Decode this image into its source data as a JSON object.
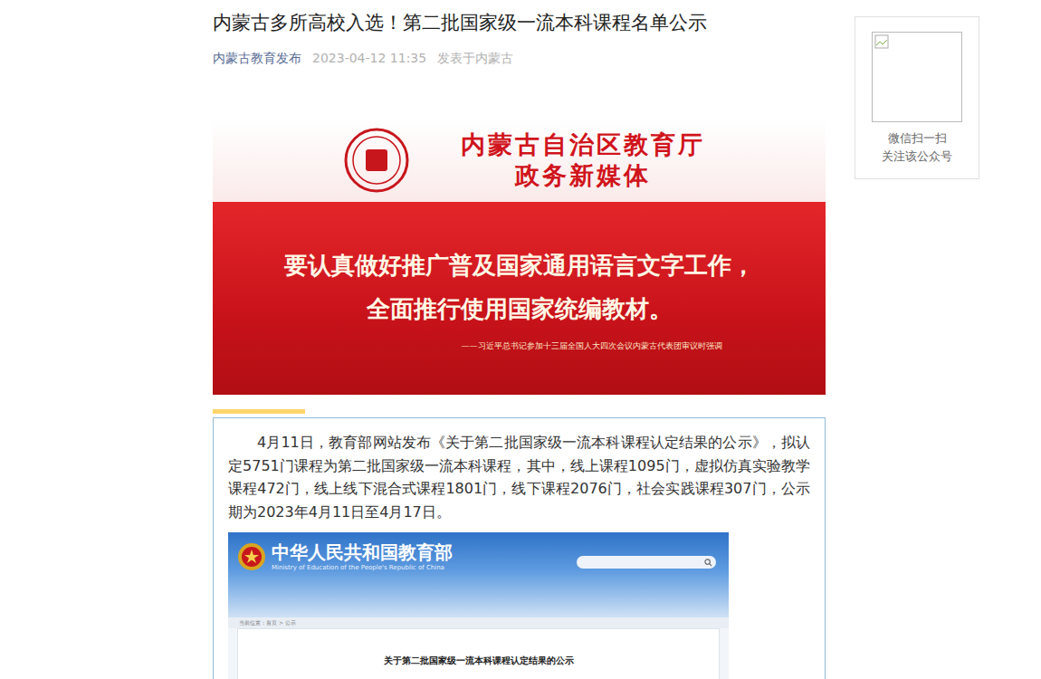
{
  "article": {
    "title": "内蒙古多所高校入选！第二批国家级一流本科课程名单公示",
    "author": "内蒙古教育发布",
    "time": "2023-04-12 11:35",
    "location": "发表于内蒙古"
  },
  "banner": {
    "header_lines": [
      "内蒙古自治区教育厅",
      "政务新媒体"
    ],
    "slogan_lines": [
      "要认真做好推广普及国家通用语言文字工作，",
      "全面推行使用国家统编教材。"
    ],
    "attribution": "——习近平总书记参加十三届全国人大四次会议内蒙古代表团审议时强调"
  },
  "body": {
    "paragraph": "4月11日，教育部网站发布《关于第二批国家级一流本科课程认定结果的公示》，拟认定5751门课程为第二批国家级一流本科课程，其中，线上课程1095门，虚拟仿真实验教学课程472门，线上线下混合式课程1801门，线下课程2076门，社会实践课程307门，公示期为2023年4月11日至4月17日。"
  },
  "embedded_page": {
    "site_name": "中华人民共和国教育部",
    "site_name_en": "Ministry of Education of the People's Republic of China",
    "breadcrumb": "当前位置：首页 > 公示",
    "doc_title": "关于第二批国家级一流本科课程认定结果的公示"
  },
  "qr_card": {
    "lines": [
      "微信扫一扫",
      "关注该公众号"
    ]
  }
}
